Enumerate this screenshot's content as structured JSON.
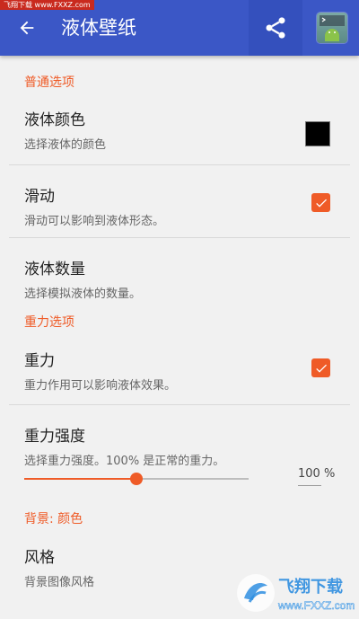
{
  "watermark_top": "飞翔下载 www.FXXZ.com",
  "appbar": {
    "title": "液体壁纸"
  },
  "sections": {
    "general": "普通选项",
    "gravity": "重力选项",
    "background": "背景: 颜色"
  },
  "rows": {
    "liquid_color": {
      "title": "液体颜色",
      "subtitle": "选择液体的颜色",
      "swatch_color": "#000000"
    },
    "slide": {
      "title": "滑动",
      "subtitle": "滑动可以影响到液体形态。",
      "checked": true
    },
    "liquid_count": {
      "title": "液体数量",
      "subtitle": "选择模拟液体的数量。"
    },
    "gravity": {
      "title": "重力",
      "subtitle": "重力作用可以影响液体效果。",
      "checked": true
    },
    "gravity_strength": {
      "title": "重力强度",
      "subtitle": "选择重力强度。100% 是正常的重力。",
      "value_label": "100 %",
      "slider_fraction": 0.5
    },
    "style": {
      "title": "风格",
      "subtitle": "背景图像风格"
    }
  },
  "watermark_logo": {
    "name": "飞翔下载",
    "url": "www.FXXZ.com"
  },
  "colors": {
    "appbar": "#3b57c6",
    "accent": "#ef5b27"
  }
}
